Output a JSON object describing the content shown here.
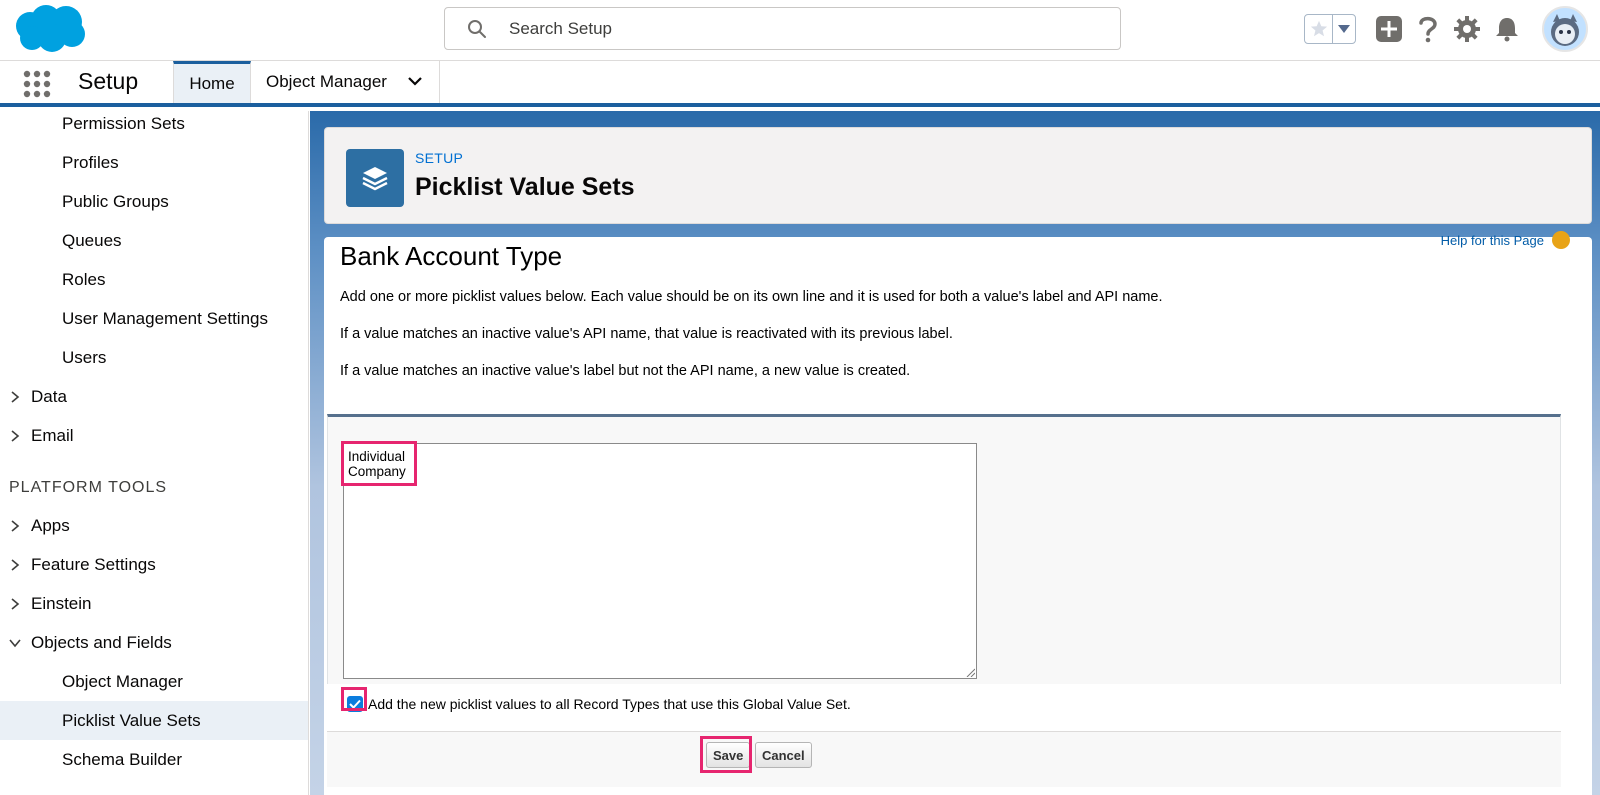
{
  "header": {
    "search_placeholder": "Search Setup",
    "icons": [
      "salesforce-cloud-logo",
      "search-icon",
      "favorites-star-icon",
      "favorites-caret-icon",
      "global-add-icon",
      "help-icon",
      "setup-gear-icon",
      "notifications-bell-icon",
      "user-avatar"
    ]
  },
  "nav": {
    "app_name": "Setup",
    "tabs": [
      {
        "label": "Home"
      },
      {
        "label": "Object Manager"
      }
    ]
  },
  "sidebar": {
    "items": [
      {
        "label": "Permission Sets",
        "level": "sub"
      },
      {
        "label": "Profiles",
        "level": "sub"
      },
      {
        "label": "Public Groups",
        "level": "sub"
      },
      {
        "label": "Queues",
        "level": "sub"
      },
      {
        "label": "Roles",
        "level": "sub"
      },
      {
        "label": "User Management Settings",
        "level": "sub"
      },
      {
        "label": "Users",
        "level": "sub"
      },
      {
        "label": "Data",
        "level": "top"
      },
      {
        "label": "Email",
        "level": "top"
      },
      {
        "label": "Apps",
        "level": "top"
      },
      {
        "label": "Feature Settings",
        "level": "top"
      },
      {
        "label": "Einstein",
        "level": "top"
      },
      {
        "label": "Objects and Fields",
        "level": "top"
      },
      {
        "label": "Object Manager",
        "level": "sub"
      },
      {
        "label": "Picklist Value Sets",
        "level": "sub",
        "selected": true
      },
      {
        "label": "Schema Builder",
        "level": "sub"
      }
    ],
    "section_platform_tools": "PLATFORM TOOLS"
  },
  "page_header": {
    "eyebrow": "SETUP",
    "title": "Picklist Value Sets"
  },
  "main": {
    "title": "Bank Account Type",
    "help_link": "Help for this Page",
    "para1": "Add one or more picklist values below. Each value should be on its own line and it is used for both a value's label and API name.",
    "para2": "If a value matches an inactive value's API name, that value is reactivated with its previous label.",
    "para3": "If a value matches an inactive value's label but not the API name, a new value is created.",
    "textarea_lines": [
      "Individual",
      "Company"
    ],
    "checkbox_label": "Add the new picklist values to all Record Types that use this Global Value Set.",
    "checkbox_checked": true,
    "save_label": "Save",
    "cancel_label": "Cancel"
  },
  "colors": {
    "brand_blue": "#1b5f9e",
    "link_blue": "#0070d2",
    "highlight_pink": "#e6256f",
    "checkbox_blue": "#0b7dde"
  }
}
